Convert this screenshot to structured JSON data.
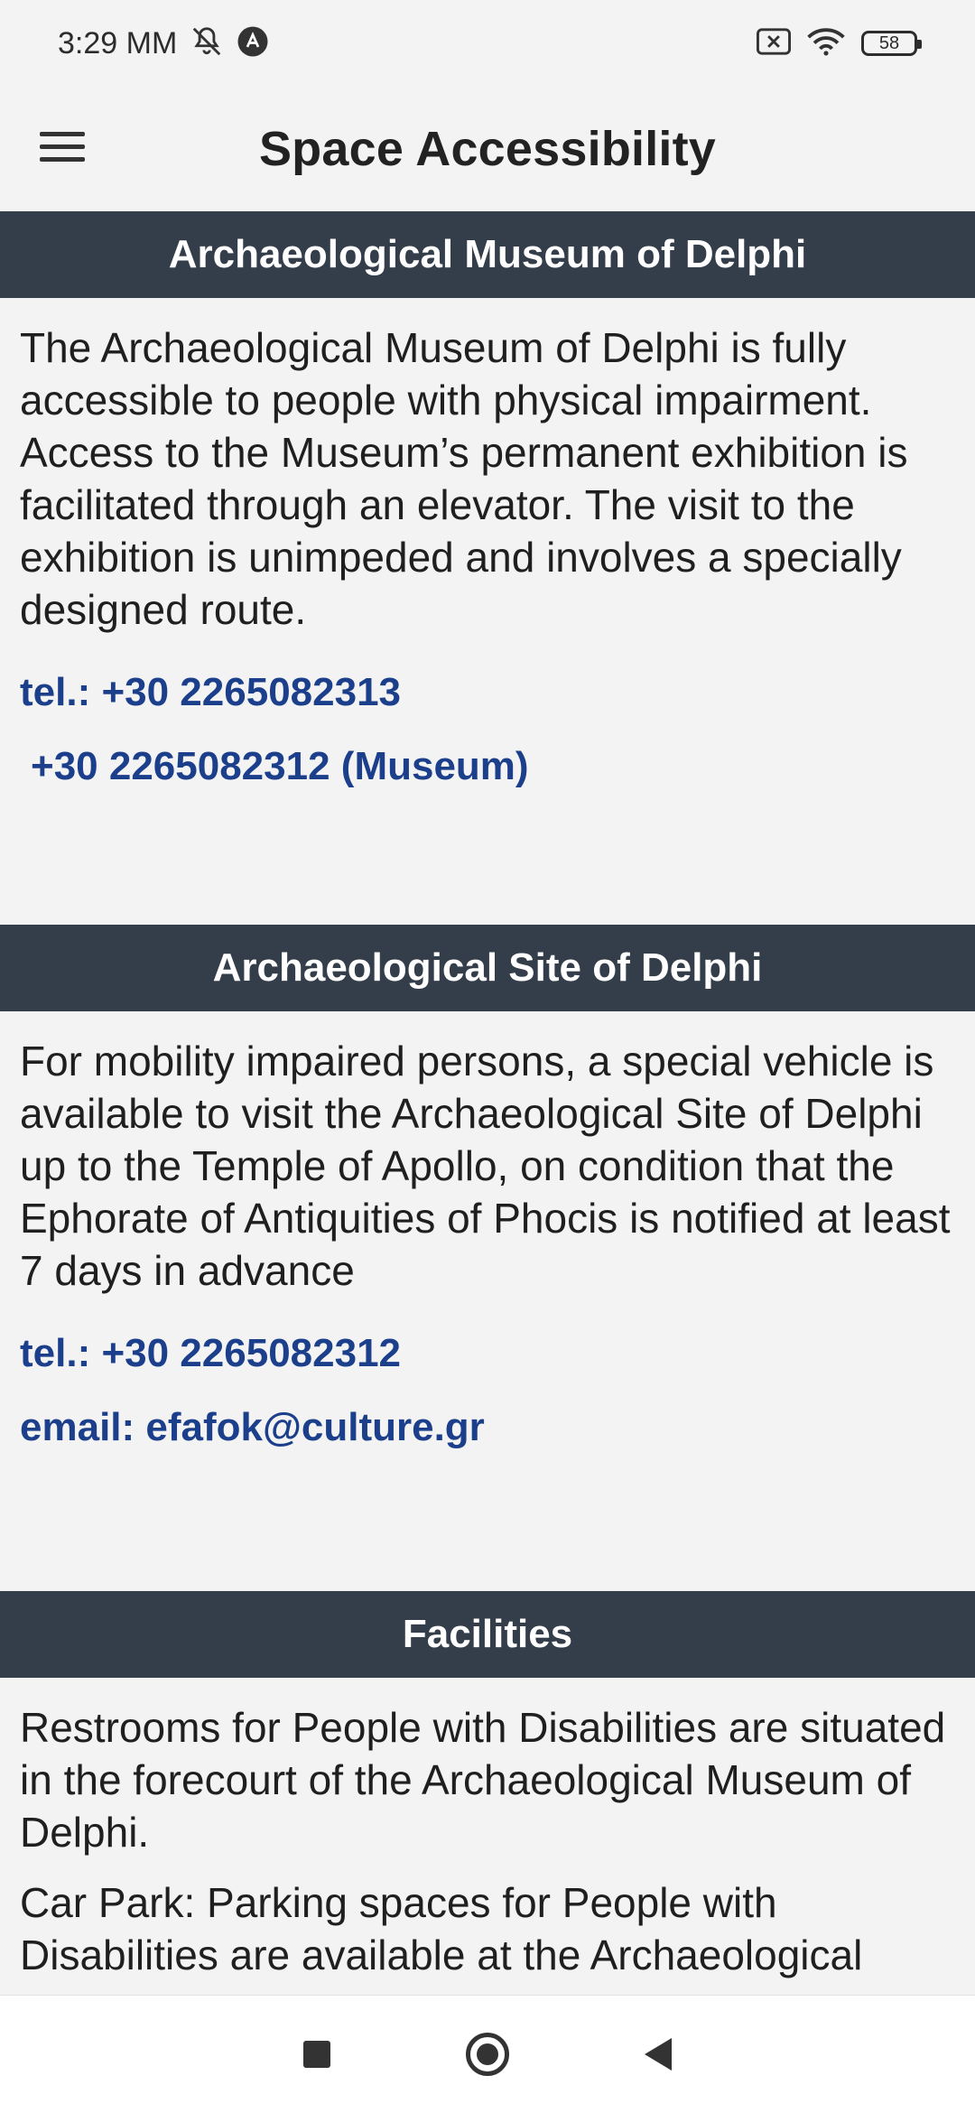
{
  "status_bar": {
    "time": "3:29 MM",
    "battery": "58",
    "icons": [
      "bell-muted-icon",
      "app-a-icon",
      "sim-x-icon",
      "wifi-icon",
      "battery-icon"
    ]
  },
  "app_bar": {
    "title": "Space Accessibility",
    "menu_icon": "hamburger-menu-icon"
  },
  "sections": [
    {
      "title": "Archaeological Museum of Delphi",
      "paragraph": "The Archaeological Museum of Delphi is fully accessible to people with physical impairment. Access to the Museum’s permanent exhibition is facilitated through an elevator. The visit to the exhibition is unimpeded and involves a specially designed route.",
      "link1": "tel.: +30 2265082313",
      "link2": "+30 2265082312 (Museum)"
    },
    {
      "title": "Archaeological Site of Delphi",
      "paragraph": "For mobility impaired persons, a special vehicle is available to visit the Archaeological Site of Delphi up to the Temple of Apollo, on condition that the Ephorate of Antiquities of Phocis is notified at least 7 days in advance",
      "link1": "tel.: +30 2265082312",
      "link2": "email: efafok@culture.gr"
    },
    {
      "title": "Facilities",
      "paragraph1": "Restrooms for People with Disabilities are situated in the forecourt of the Archaeological Museum of Delphi.",
      "paragraph2": "Car Park: Parking spaces for People with Disabilities are available at the Archaeological"
    }
  ],
  "nav_bar": {
    "icons": [
      "recent-apps-icon",
      "home-icon",
      "back-icon"
    ]
  },
  "colors": {
    "header_bg": "#343d4a",
    "link": "#1c3f8c",
    "background": "#f3f3f3"
  }
}
